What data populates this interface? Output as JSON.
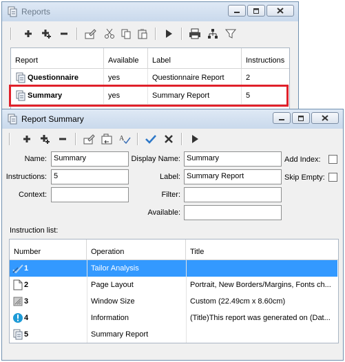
{
  "reports_window": {
    "title": "Reports",
    "toolbar": [
      "add-icon",
      "add-multiple-icon",
      "remove-icon",
      "edit-icon",
      "cut-icon",
      "copy-icon",
      "paste-icon",
      "run-icon",
      "print-icon",
      "hierarchy-icon",
      "filter-icon"
    ],
    "columns": [
      "Report",
      "Available",
      "Label",
      "Instructions"
    ],
    "rows": [
      {
        "name": "Questionnaire",
        "available": "yes",
        "label": "Questionnaire Report",
        "instructions": "2"
      },
      {
        "name": "Summary",
        "available": "yes",
        "label": "Summary Report",
        "instructions": "5"
      }
    ],
    "highlight_color": "#e0202a"
  },
  "summary_window": {
    "title": "Report Summary",
    "toolbar": [
      "add-icon",
      "add-multiple-icon",
      "remove-icon",
      "edit-icon",
      "move-icon",
      "spellcheck-icon",
      "check-icon",
      "delete-icon",
      "run-icon"
    ],
    "fields": {
      "name_label": "Name:",
      "name_value": "Summary",
      "instructions_label": "Instructions:",
      "instructions_value": "5",
      "context_label": "Context:",
      "context_value": "",
      "display_name_label": "Display Name:",
      "display_name_value": "Summary",
      "label_label": "Label:",
      "label_value": "Summary Report",
      "filter_label": "Filter:",
      "filter_value": "",
      "available_label": "Available:",
      "available_value": "",
      "add_index_label": "Add Index:",
      "skip_empty_label": "Skip Empty:"
    },
    "instruction_list_label": "Instruction list:",
    "columns": [
      "Number",
      "Operation",
      "Title"
    ],
    "instructions": [
      {
        "number": "1",
        "operation": "Tailor Analysis",
        "title": "",
        "icon": "tailor-icon"
      },
      {
        "number": "2",
        "operation": "Page Layout",
        "title": "Portrait, New Borders/Margins, Fonts ch...",
        "icon": "page-icon"
      },
      {
        "number": "3",
        "operation": "Window Size",
        "title": "Custom (22.49cm x 8.60cm)",
        "icon": "window-size-icon"
      },
      {
        "number": "4",
        "operation": "Information",
        "title": "(Title)This report was generated on (Dat...",
        "icon": "info-icon"
      },
      {
        "number": "5",
        "operation": "Summary Report",
        "title": "",
        "icon": "report-icon"
      }
    ],
    "selected_color": "#3399ff"
  }
}
